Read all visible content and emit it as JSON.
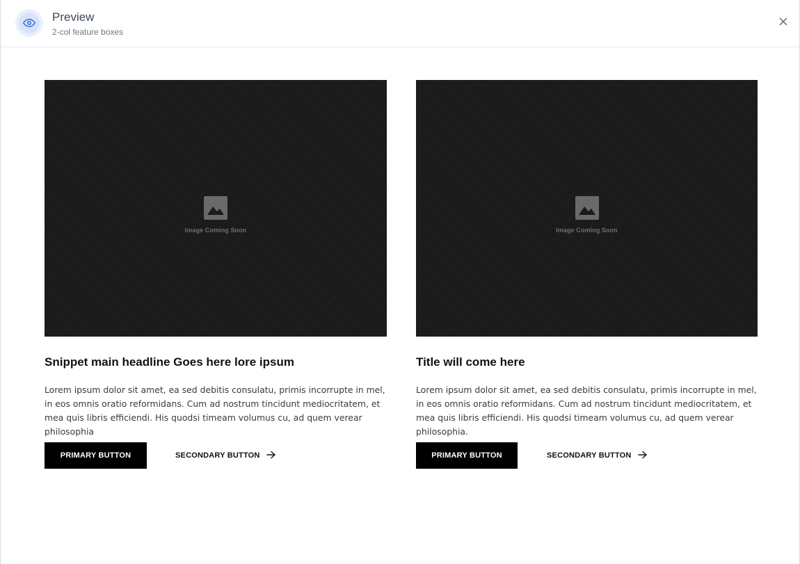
{
  "header": {
    "title": "Preview",
    "subtitle": "2-col feature boxes",
    "icon": "eye-icon",
    "close_icon": "close-icon"
  },
  "cards": [
    {
      "image_label": "Image Coming Soon",
      "headline": "Snippet main headline Goes here lore ipsum",
      "body": "Lorem ipsum dolor sit amet, ea sed debitis consulatu, primis incorrupte in mel, in eos omnis oratio reformidans. Cum ad nostrum tincidunt mediocritatem, et mea quis libris efficiendi. His quodsi timeam volumus cu, ad quem verear philosophia",
      "primary_label": "PRIMARY BUTTON",
      "secondary_label": "SECONDARY BUTTON"
    },
    {
      "image_label": "Image Coming Soon",
      "headline": "Title will come here",
      "body": "Lorem ipsum dolor sit amet, ea sed debitis consulatu, primis incorrupte in mel, in eos omnis oratio reformidans. Cum ad nostrum tincidunt mediocritatem, et mea quis libris efficiendi. His quodsi timeam volumus cu, ad quem verear philosophia.",
      "primary_label": "PRIMARY BUTTON",
      "secondary_label": "SECONDARY BUTTON"
    }
  ],
  "colors": {
    "accent": "#2f6fd6",
    "image_bg": "#1b1b1b",
    "primary_button_bg": "#000000"
  }
}
